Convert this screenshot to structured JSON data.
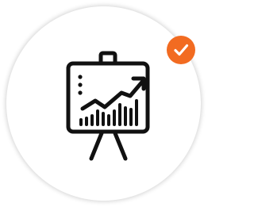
{
  "item": {
    "icon": "presentation-chart-icon",
    "selected": true
  },
  "badge": {
    "icon": "checkmark-icon",
    "color": "#F26B21",
    "check_color": "#ffffff"
  },
  "colors": {
    "icon_stroke": "#111111",
    "card_background": "#ffffff"
  }
}
